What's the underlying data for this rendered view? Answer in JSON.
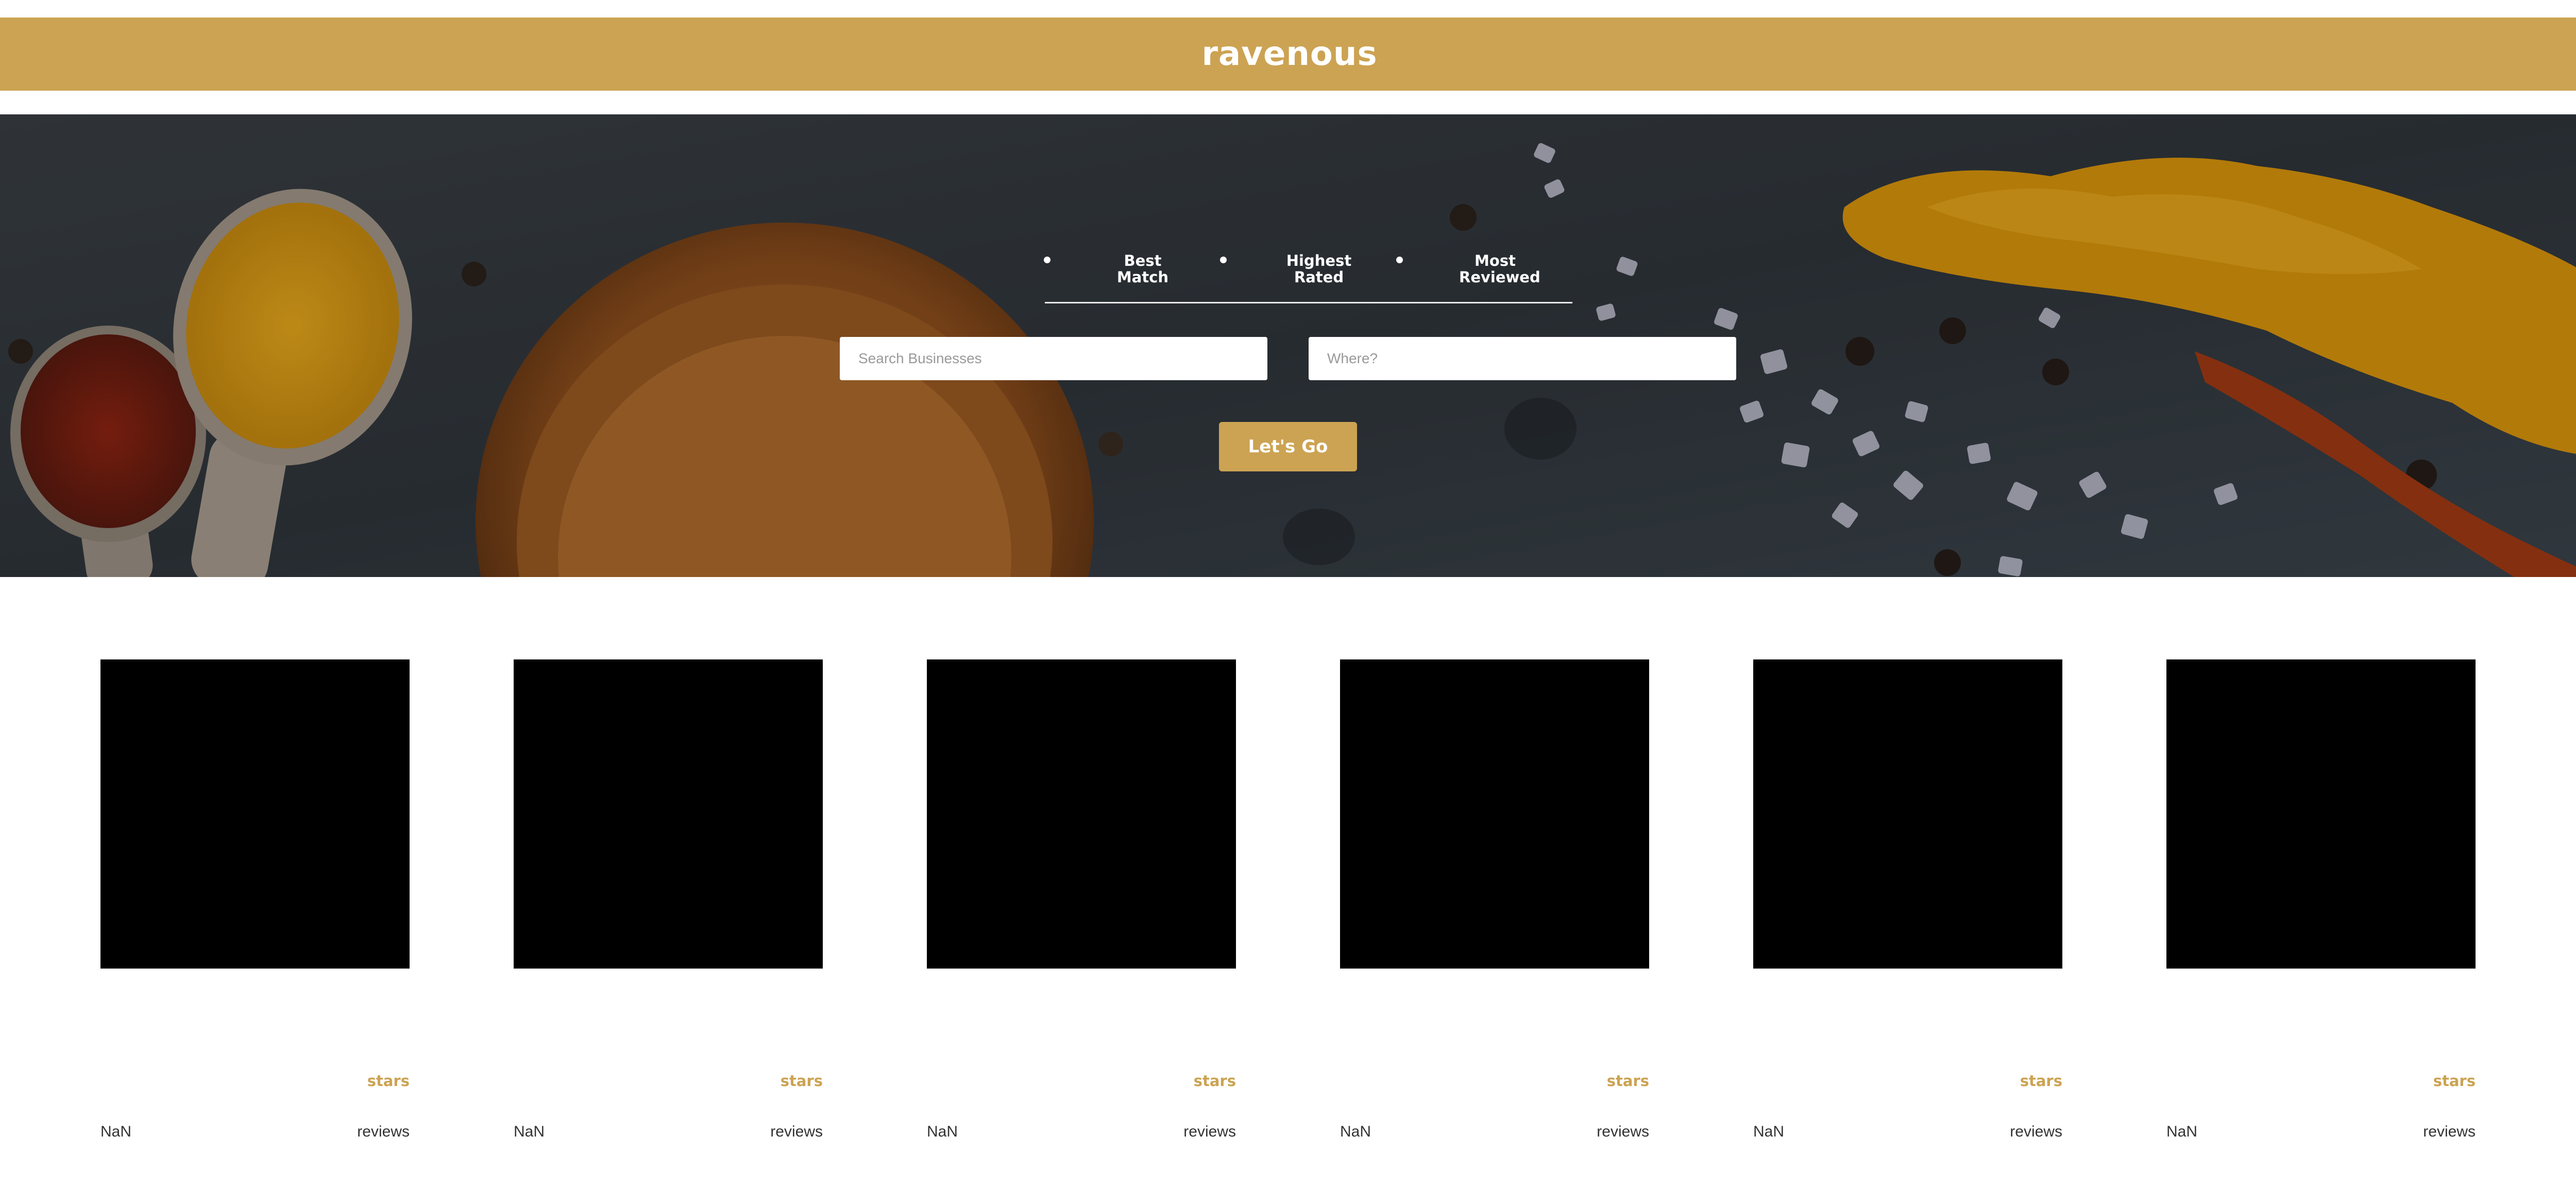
{
  "header": {
    "logo": "ravenous",
    "brand_color": "#cca353"
  },
  "sort_options": [
    {
      "label": "Best Match"
    },
    {
      "label": "Highest Rated"
    },
    {
      "label": "Most Reviewed"
    }
  ],
  "search": {
    "term_placeholder": "Search Businesses",
    "location_placeholder": "Where?",
    "submit_label": "Let's Go"
  },
  "businesses": [
    {
      "stars_label": "stars",
      "rating": "NaN",
      "reviews_label": "reviews"
    },
    {
      "stars_label": "stars",
      "rating": "NaN",
      "reviews_label": "reviews"
    },
    {
      "stars_label": "stars",
      "rating": "NaN",
      "reviews_label": "reviews"
    },
    {
      "stars_label": "stars",
      "rating": "NaN",
      "reviews_label": "reviews"
    },
    {
      "stars_label": "stars",
      "rating": "NaN",
      "reviews_label": "reviews"
    },
    {
      "stars_label": "stars",
      "rating": "NaN",
      "reviews_label": "reviews"
    }
  ]
}
